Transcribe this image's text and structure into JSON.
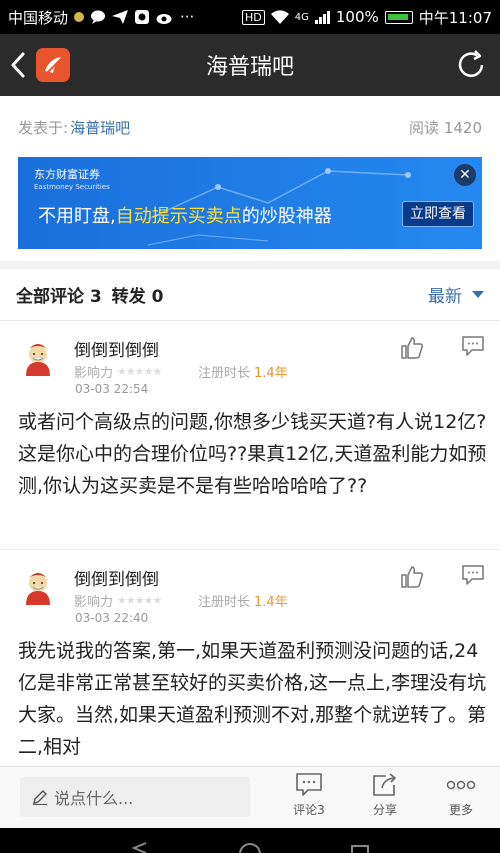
{
  "status": {
    "carrier": "中国移动",
    "more": "···",
    "hd": "HD",
    "net": "4G",
    "battery": "100%",
    "time": "中午11:07"
  },
  "header": {
    "title": "海普瑞吧"
  },
  "meta": {
    "posted_by_label": "发表于:",
    "author": "海普瑞吧",
    "reads": "阅读 1420"
  },
  "banner": {
    "brand": "东方财富证券",
    "brand_en": "Eastmoney Securities",
    "text_a": "不用盯盘,",
    "text_b": "自动提示买卖点",
    "text_c": "的炒股神器",
    "button": "立即查看",
    "close": "✕"
  },
  "tabs": {
    "comments": "全部评论 3",
    "forwards": "转发 0",
    "sort": "最新"
  },
  "comments": [
    {
      "user": "倒倒到倒倒",
      "influence_label": "影响力",
      "reg_label": "注册时长",
      "reg_years": "1.4年",
      "time": "03-03 22:54",
      "text": "或者问个高级点的问题,你想多少钱买天道?有人说12亿?这是你心中的合理价位吗??果真12亿,天道盈利能力如预测,你认为这买卖是不是有些哈哈哈哈了??"
    },
    {
      "user": "倒倒到倒倒",
      "influence_label": "影响力",
      "reg_label": "注册时长",
      "reg_years": "1.4年",
      "time": "03-03 22:40",
      "text": "我先说我的答案,第一,如果天道盈利预测没问题的话,24亿是非常正常甚至较好的买卖价格,这一点上,李理没有坑大家。当然,如果天道盈利预测不对,那整个就逆转了。第二,相对"
    }
  ],
  "bottom": {
    "input_placeholder": "说点什么...",
    "comment": "评论3",
    "share": "分享",
    "more": "更多"
  },
  "colors": {
    "header_bg": "#2b2b2b",
    "accent": "#3a6ea8",
    "banner_bg": "#1a6fdc",
    "highlight": "#ffe033",
    "reg_years": "#e8952c"
  }
}
